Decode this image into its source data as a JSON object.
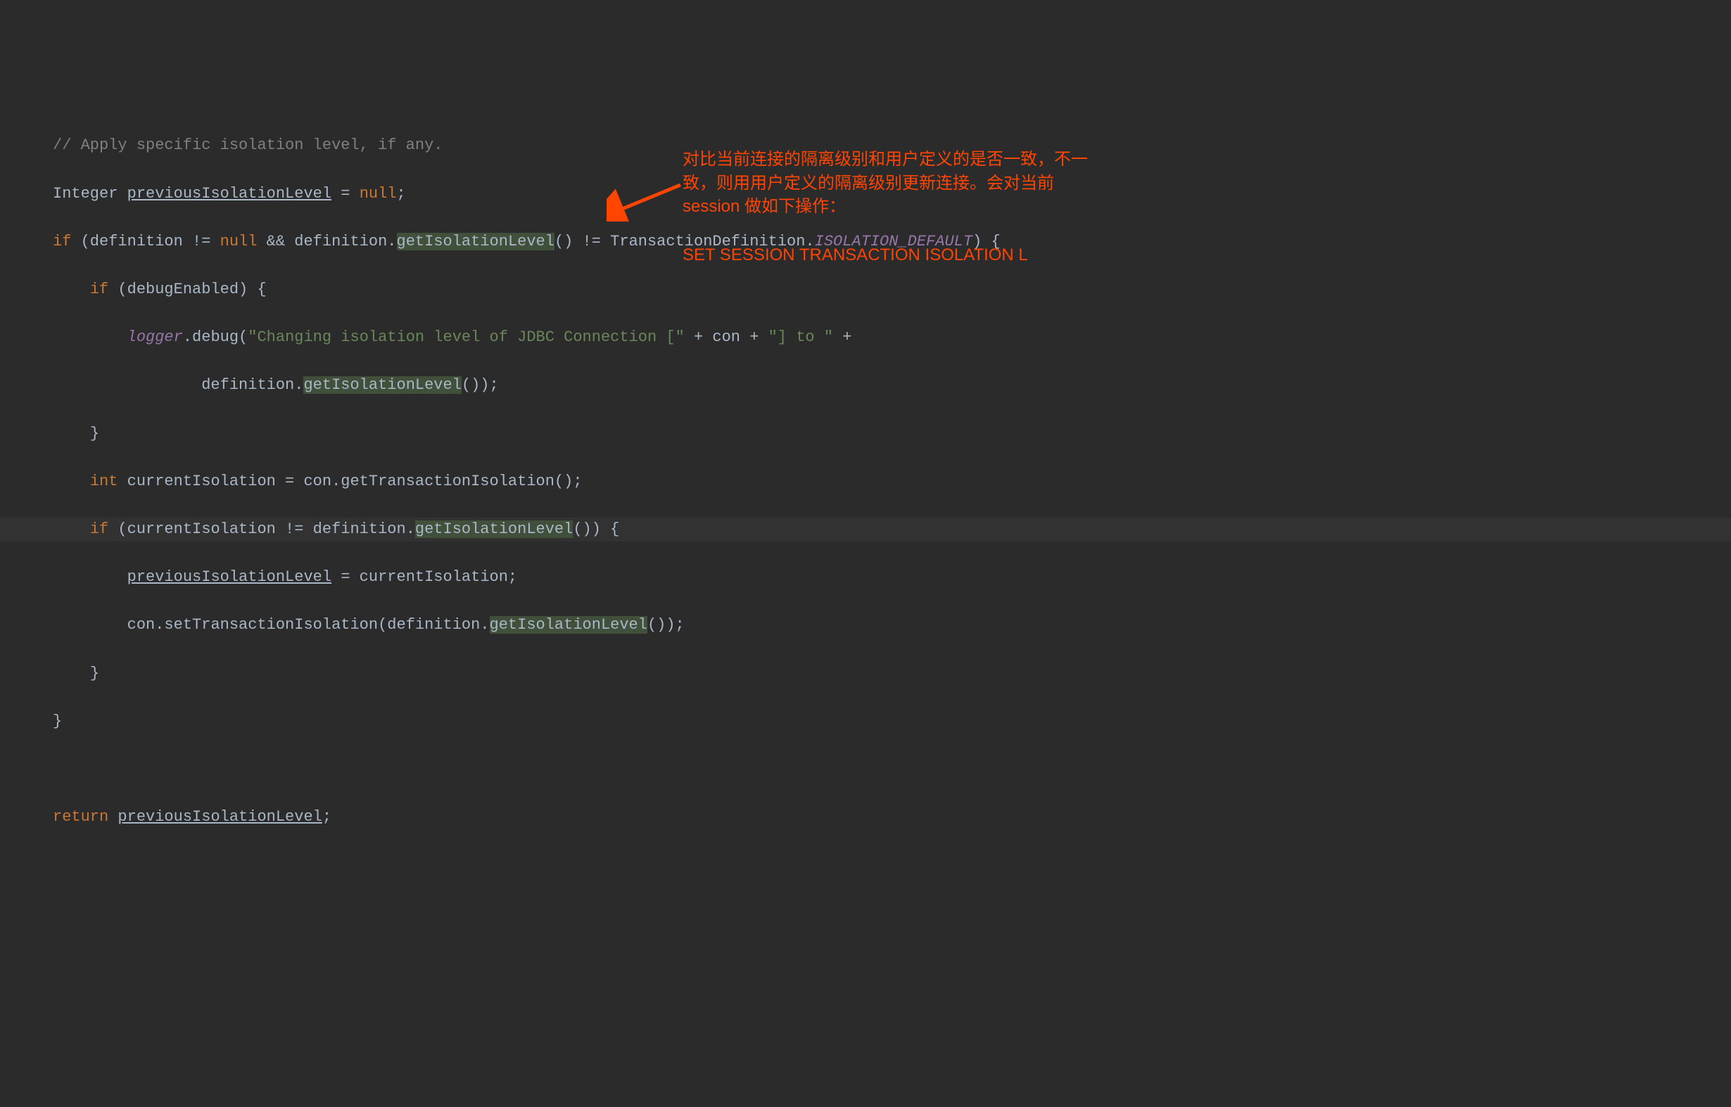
{
  "code": {
    "line1_comment": "// Apply specific isolation level, if any.",
    "line2_type": "Integer ",
    "line2_var": "previousIsolationLevel",
    "line2_assign": " = ",
    "line2_null": "null",
    "line2_semi": ";",
    "line3_if": "if ",
    "line3_open": "(definition != ",
    "line3_null": "null",
    "line3_and": " && definition.",
    "line3_method": "getIsolationLevel",
    "line3_after": "() != TransactionDefinition.",
    "line3_const": "ISOLATION_DEFAULT",
    "line3_close": ") {",
    "line4_if": "if ",
    "line4_cond": "(debugEnabled) {",
    "line5_logger": "logger",
    "line5_debug": ".debug(",
    "line5_str": "\"Changing isolation level of JDBC Connection [\"",
    "line5_plus1": " + con + ",
    "line5_str2": "\"] to \"",
    "line5_plus2": " +",
    "line6_def": "definition.",
    "line6_method": "getIsolationLevel",
    "line6_close": "());",
    "line7_brace": "}",
    "line8_int": "int ",
    "line8_var": "currentIsolation = con.getTransactionIsolation();",
    "line9_if": "if ",
    "line9_open": "(currentIsolation != definition.",
    "line9_method": "getIsolationLevel",
    "line9_close": "()) {",
    "line10_var": "previousIsolationLevel",
    "line10_assign": " = currentIsolation;",
    "line11_call": "con.setTransactionIsolation(definition.",
    "line11_method": "getIsolationLevel",
    "line11_close": "());",
    "line12_brace": "}",
    "line13_brace": "}",
    "line15_return": "return ",
    "line15_var": "previousIsolationLevel",
    "line15_semi": ";"
  },
  "annotation": {
    "text1": "对比当前连接的隔离级别和用户定义的是否一致，不一致，则用用户定义的隔离级别更新连接。会对当前 session 做如下操作：",
    "text2": "SET SESSION TRANSACTION ISOLATION L"
  }
}
